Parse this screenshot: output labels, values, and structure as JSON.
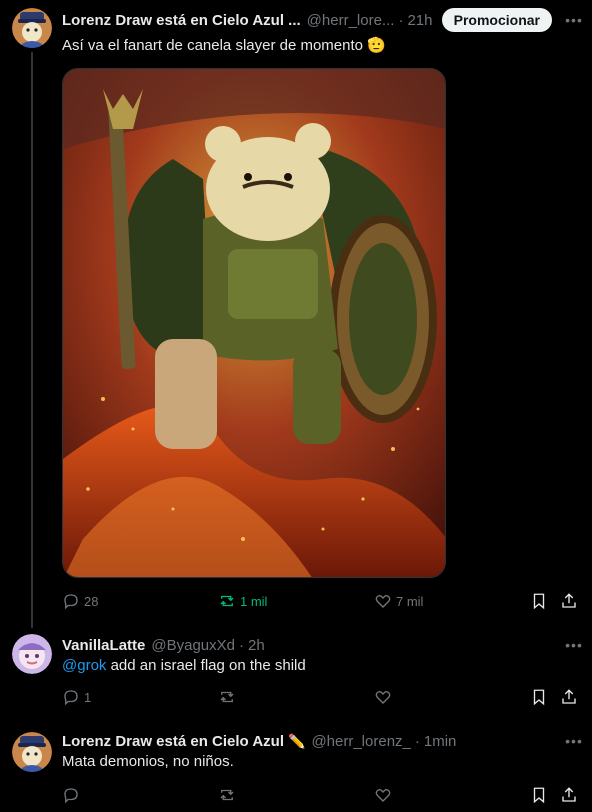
{
  "post1": {
    "author": "Lorenz Draw está en Cielo Azul ...",
    "handle": "@herr_lore...",
    "time": "21h",
    "promote_label": "Promocionar",
    "text": "Así va el fanart de canela slayer de momento",
    "emoji": "🫡",
    "replies": "28",
    "reposts": "1 mil",
    "likes": "7 mil"
  },
  "post2": {
    "author": "VanillaLatte",
    "handle": "@ByaguxXd",
    "time": "2h",
    "mention": "@grok",
    "text": " add an israel flag on the shild",
    "replies": "1"
  },
  "post3": {
    "author": "Lorenz Draw está en Cielo Azul",
    "author_emoji": "✏️",
    "handle": "@herr_lorenz_",
    "time": "1min",
    "text": "Mata demonios, no niños."
  },
  "colors": {
    "accent": "#1d9bf0",
    "repost_active": "#00ba7c",
    "muted": "#71767b"
  },
  "icons": [
    "more-icon",
    "reply-icon",
    "repost-icon",
    "like-icon",
    "bookmark-icon",
    "share-icon"
  ]
}
